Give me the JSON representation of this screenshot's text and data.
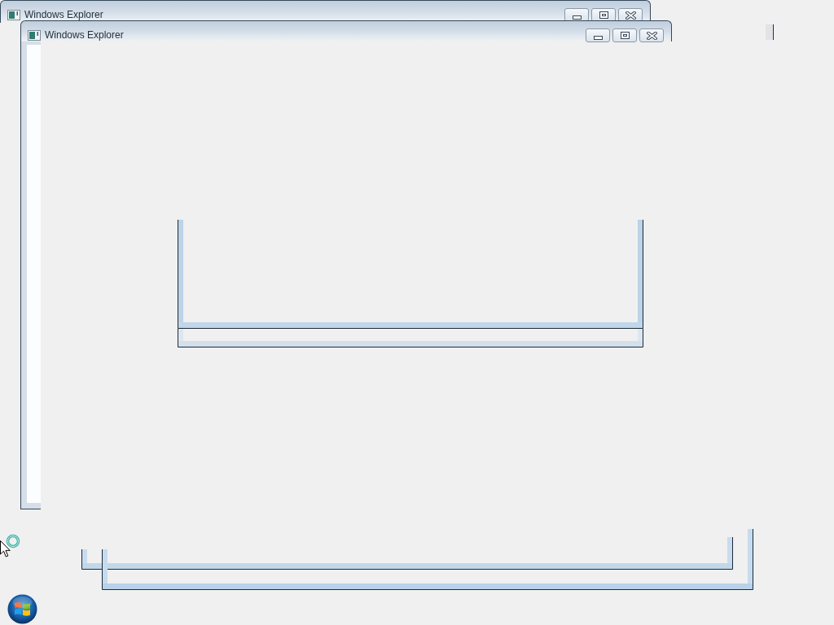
{
  "windows": [
    {
      "title": "Windows Explorer"
    },
    {
      "title": "Windows Explorer"
    }
  ]
}
